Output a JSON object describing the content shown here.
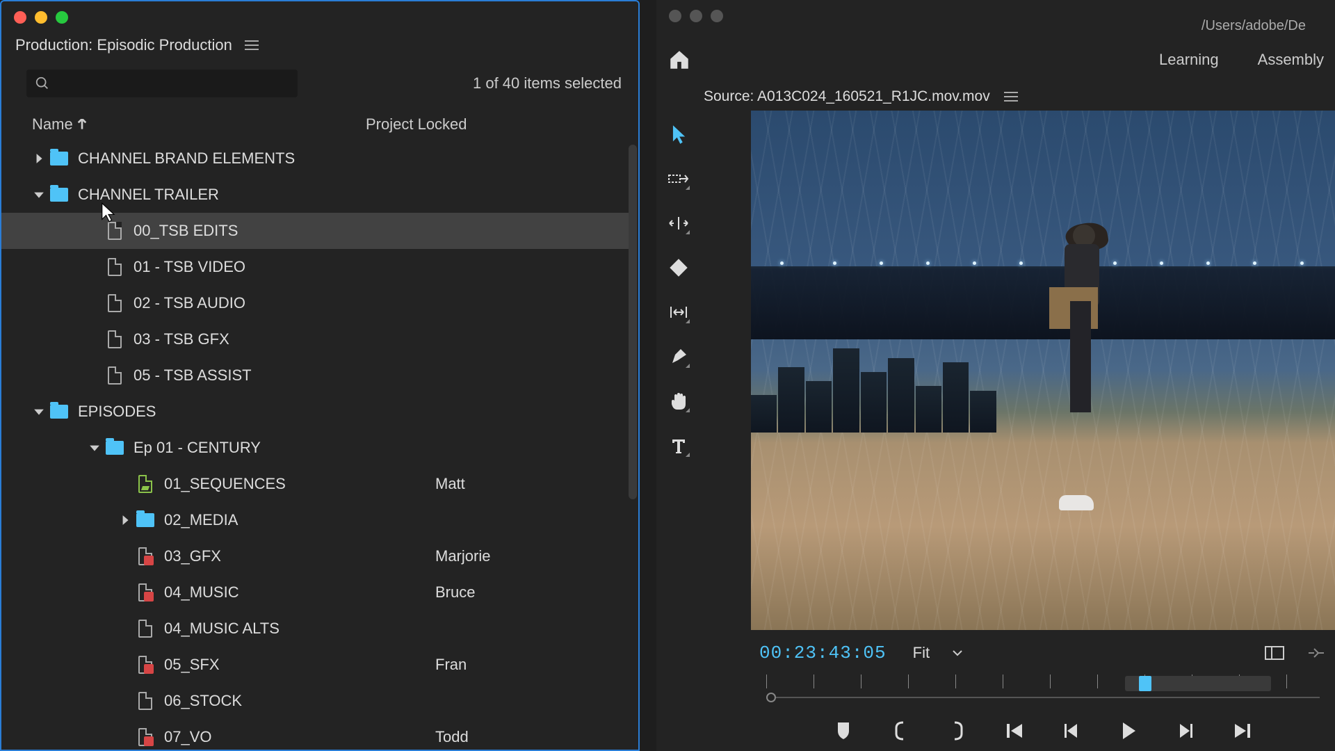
{
  "left": {
    "title": "Production: Episodic Production",
    "status": "1 of 40 items selected",
    "cols": {
      "name": "Name",
      "locked": "Project Locked"
    },
    "tree": [
      {
        "ind": 0,
        "chev": "right",
        "icon": "folder",
        "label": "CHANNEL BRAND ELEMENTS",
        "locked": ""
      },
      {
        "ind": 0,
        "chev": "down",
        "icon": "folder",
        "label": "CHANNEL TRAILER",
        "locked": ""
      },
      {
        "ind": 1,
        "chev": "",
        "icon": "file",
        "label": "00_TSB EDITS",
        "locked": "",
        "selected": true
      },
      {
        "ind": 1,
        "chev": "",
        "icon": "file",
        "label": "01 - TSB VIDEO",
        "locked": ""
      },
      {
        "ind": 1,
        "chev": "",
        "icon": "file",
        "label": "02 - TSB AUDIO",
        "locked": ""
      },
      {
        "ind": 1,
        "chev": "",
        "icon": "file",
        "label": "03 - TSB GFX",
        "locked": ""
      },
      {
        "ind": 1,
        "chev": "",
        "icon": "file",
        "label": "05 - TSB ASSIST",
        "locked": ""
      },
      {
        "ind": 0,
        "chev": "down",
        "icon": "folder",
        "label": "EPISODES",
        "locked": ""
      },
      {
        "ind": 2,
        "chev": "down",
        "icon": "folder",
        "label": "Ep 01 - CENTURY",
        "locked": ""
      },
      {
        "ind": 3,
        "chev": "",
        "icon": "file-green",
        "label": "01_SEQUENCES",
        "locked": "Matt"
      },
      {
        "ind": 3,
        "chev": "right",
        "icon": "folder",
        "label": "02_MEDIA",
        "locked": ""
      },
      {
        "ind": 3,
        "chev": "",
        "icon": "file-locked",
        "label": "03_GFX",
        "locked": "Marjorie"
      },
      {
        "ind": 3,
        "chev": "",
        "icon": "file-locked",
        "label": "04_MUSIC",
        "locked": "Bruce"
      },
      {
        "ind": 3,
        "chev": "",
        "icon": "file",
        "label": "04_MUSIC ALTS",
        "locked": ""
      },
      {
        "ind": 3,
        "chev": "",
        "icon": "file-locked",
        "label": "05_SFX",
        "locked": "Fran"
      },
      {
        "ind": 3,
        "chev": "",
        "icon": "file",
        "label": "06_STOCK",
        "locked": ""
      },
      {
        "ind": 3,
        "chev": "",
        "icon": "file-locked",
        "label": "07_VO",
        "locked": "Todd"
      }
    ]
  },
  "right": {
    "path": "/Users/adobe/De",
    "tabs": [
      "Learning",
      "Assembly"
    ],
    "source_label": "Source: A013C024_160521_R1JC.mov.mov",
    "timecode": "00:23:43:05",
    "fit": "Fit"
  }
}
